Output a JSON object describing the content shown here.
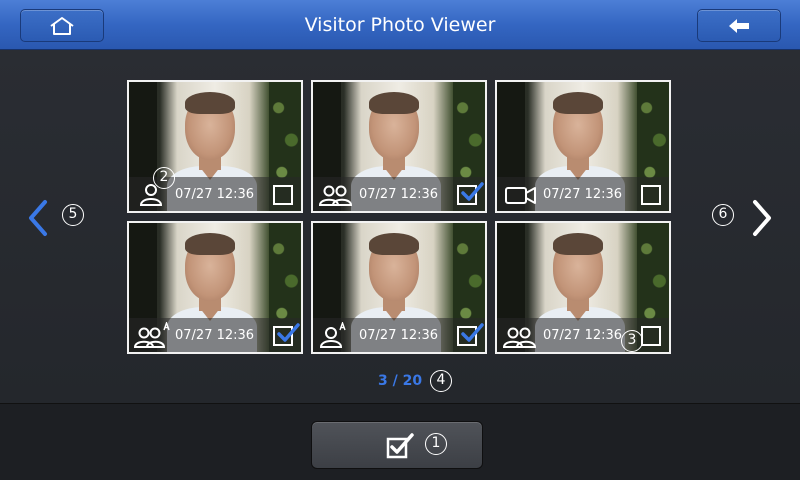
{
  "header": {
    "title": "Visitor Photo Viewer"
  },
  "icons": {
    "home": "home-icon",
    "back": "back-arrow-icon",
    "prev": "chevron-left-icon",
    "next": "chevron-right-icon",
    "confirm": "checkbox-icon"
  },
  "colors": {
    "header_blue": "#3466c2",
    "accent_blue": "#3a78e6",
    "background": "#24272c"
  },
  "thumbnails": [
    {
      "timestamp": "07/27 12:36",
      "icon": "person-icon",
      "checked": false
    },
    {
      "timestamp": "07/27 12:36",
      "icon": "two-persons-icon",
      "checked": true
    },
    {
      "timestamp": "07/27 12:36",
      "icon": "video-camera-icon",
      "checked": false
    },
    {
      "timestamp": "07/27 12:36",
      "icon": "two-persons-a-icon",
      "checked": true
    },
    {
      "timestamp": "07/27 12:36",
      "icon": "person-a-icon",
      "checked": true
    },
    {
      "timestamp": "07/27 12:36",
      "icon": "two-persons-icon",
      "checked": false
    }
  ],
  "pagination": {
    "text": "3 / 20"
  },
  "callouts": {
    "c1": "1",
    "c2": "2",
    "c3": "3",
    "c4": "4",
    "c5": "5",
    "c6": "6"
  }
}
